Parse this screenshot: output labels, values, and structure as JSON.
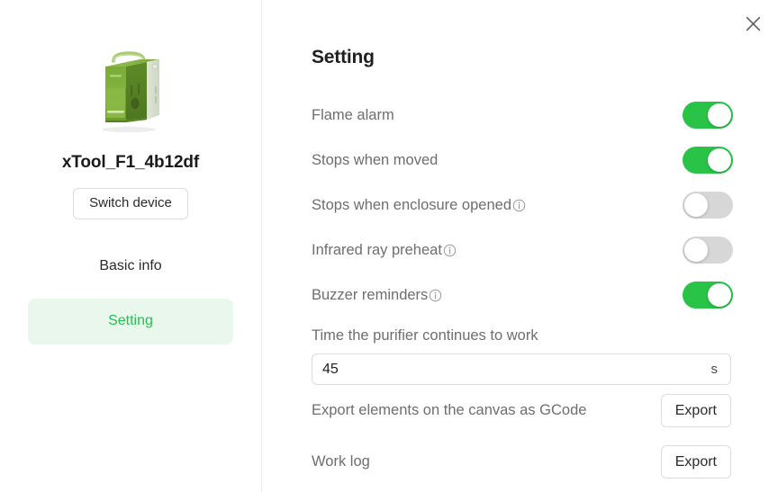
{
  "window": {
    "close_icon": "close-icon"
  },
  "sidebar": {
    "device_image_alt": "xtool-f1-device-image",
    "device_name": "xTool_F1_4b12df",
    "switch_device_label": "Switch device",
    "nav_items": [
      {
        "label": "Basic info",
        "active": false
      },
      {
        "label": "Setting",
        "active": true
      }
    ]
  },
  "panel": {
    "title": "Setting",
    "toggles": [
      {
        "label": "Flame alarm",
        "has_info": false,
        "on": true
      },
      {
        "label": "Stops when moved",
        "has_info": false,
        "on": true
      },
      {
        "label": "Stops when enclosure opened",
        "has_info": true,
        "on": false
      },
      {
        "label": "Infrared ray preheat",
        "has_info": true,
        "on": false
      },
      {
        "label": "Buzzer reminders",
        "has_info": true,
        "on": true
      }
    ],
    "purifier": {
      "label": "Time the purifier continues to work",
      "value": "45",
      "placeholder": "",
      "unit": "s"
    },
    "exports": [
      {
        "label": "Export elements on the canvas as GCode",
        "button": "Export"
      },
      {
        "label": "Work log",
        "button": "Export"
      }
    ]
  },
  "colors": {
    "accent_green": "#21c451",
    "toggle_on": "#29c348",
    "toggle_off": "#d7d7d7",
    "active_nav_bg": "#eaf7ec",
    "label_gray": "#6e6e6e",
    "border": "#dcdcdc"
  }
}
